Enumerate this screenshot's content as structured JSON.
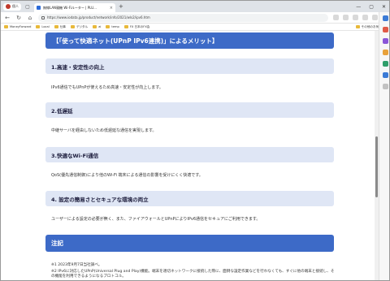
{
  "browser": {
    "profile_label": "個人",
    "tab_title": "無線LAN親機 Wi-Fiルーター | PLU...",
    "url": "https://www.iodata.jp/product/network/info/2021/wls2/ipv6.htm",
    "bookmarks": [
      "MoneyForward",
      "Local",
      "仕事",
      "デジタル",
      "ai",
      "temp",
      "FX 日本のFX会"
    ],
    "bookmarks_right": "その他のお気に入り",
    "colors": {
      "accent": "#3d6ac7",
      "subheading_bg": "#dfe6f5"
    }
  },
  "page": {
    "main_heading": "【「使って快適ネット(UPnP IPv6連携)」によるメリット】",
    "sections": [
      {
        "heading": "1.高速・安定性の向上",
        "text": "IPv6通信でもUPnPが使えるため高速・安定性が向上します。"
      },
      {
        "heading": "2.低遅延",
        "text": "中継サーバを経由しないため低遅延な通信を実現します。"
      },
      {
        "heading": "3.快適なWi-Fi通信",
        "text": "QoS(優先通信制御)により他のWi-Fi 端末による通信の影響を受けにくく快適です。"
      },
      {
        "heading": "4. 設定の簡易さとセキュアな環境の両立",
        "text": "ユーザーによる設定の必要が無く、また、ファイアウォールとUPnPによりIPv6通信をセキュアにご利用できます。"
      }
    ],
    "notes_heading": "注記",
    "notes": [
      "※1 2023年9月7日当社調べ。",
      "※2 IPv6に対応したUPnP(Universal Plug and Play)機能。端末を適切ネットワークに接続した際に、面倒な設定作業などを行わなくても、すぐに他の端末と接続し、その機能を利用できるようになるプロトコル。"
    ]
  }
}
